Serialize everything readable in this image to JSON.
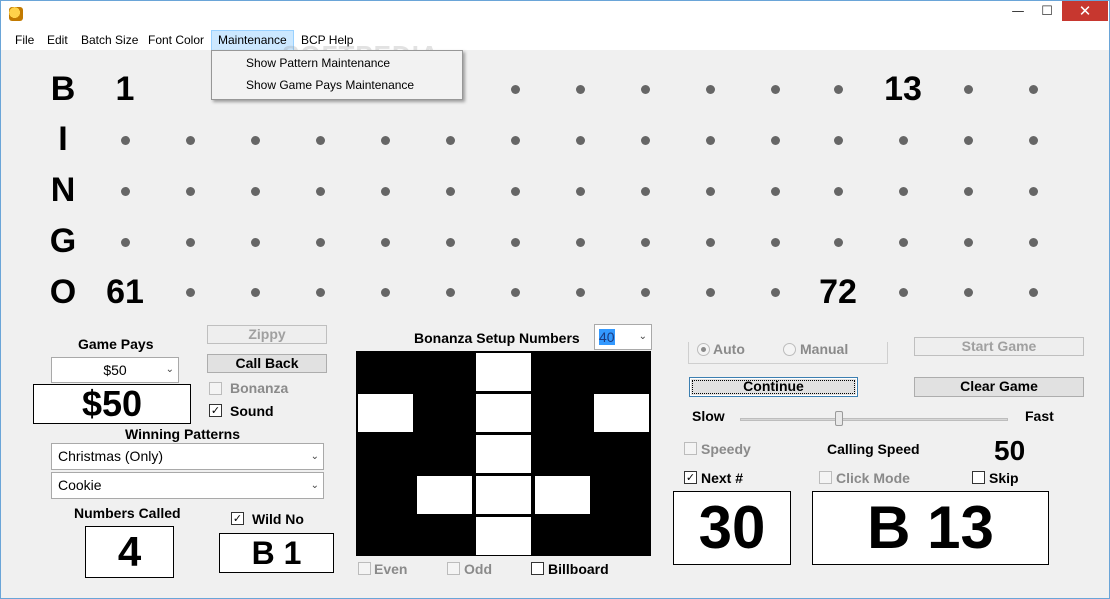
{
  "window": {
    "minimize_glyph": "—",
    "maximize_glyph": "☐",
    "close_glyph": "✕",
    "app_icon": "bingo-ball-icon"
  },
  "menu": {
    "items": [
      "File",
      "Edit",
      "Batch Size",
      "Font Color",
      "Maintenance",
      "BCP Help"
    ],
    "open_index": 4,
    "dropdown": [
      "Show Pattern Maintenance",
      "Show Game Pays Maintenance"
    ]
  },
  "watermark": "SOFTPEDIA",
  "board": {
    "letters": [
      "B",
      "I",
      "N",
      "G",
      "O"
    ],
    "called": [
      {
        "row": 0,
        "col": 0,
        "value": "1"
      },
      {
        "row": 0,
        "col": 12,
        "value": "13"
      },
      {
        "row": 4,
        "col": 0,
        "value": "61"
      },
      {
        "row": 4,
        "col": 11,
        "value": "72"
      }
    ],
    "dot_color": "#666666"
  },
  "left_panel": {
    "game_pays_label": "Game Pays",
    "game_pays_selected": "$50",
    "game_pays_display": "$50",
    "zippy_label": "Zippy",
    "call_back_label": "Call Back",
    "bonanza_label": "Bonanza",
    "bonanza_checked": false,
    "sound_label": "Sound",
    "sound_checked": true,
    "winning_patterns_label": "Winning Patterns",
    "pattern_1": "Christmas (Only)",
    "pattern_2": "Cookie",
    "numbers_called_label": "Numbers Called",
    "numbers_called_value": "4",
    "wild_no_label": "Wild No",
    "wild_no_checked": true,
    "wild_no_value": "B 1"
  },
  "bonanza": {
    "label": "Bonanza Setup Numbers",
    "selected": "40",
    "grid": [
      [
        1,
        1,
        0,
        1,
        1
      ],
      [
        0,
        1,
        0,
        1,
        0
      ],
      [
        1,
        1,
        0,
        1,
        1
      ],
      [
        1,
        0,
        0,
        0,
        1
      ],
      [
        1,
        1,
        0,
        1,
        1
      ]
    ],
    "even_label": "Even",
    "odd_label": "Odd",
    "billboard_label": "Billboard"
  },
  "right_panel": {
    "auto_label": "Auto",
    "manual_label": "Manual",
    "mode_selected": "Auto",
    "start_game_label": "Start Game",
    "continue_label": "Continue",
    "clear_game_label": "Clear Game",
    "slow_label": "Slow",
    "fast_label": "Fast",
    "speed_fraction": 0.37,
    "speedy_label": "Speedy",
    "calling_speed_label": "Calling Speed",
    "calling_speed_value": "50",
    "next_label": "Next #",
    "next_checked": true,
    "click_mode_label": "Click Mode",
    "skip_label": "Skip",
    "skip_checked": false,
    "next_number_value": "30",
    "current_call_value": "B 13"
  },
  "colors": {
    "menu_open_bg": "#cce8ff",
    "close_button": "#c7372f"
  }
}
